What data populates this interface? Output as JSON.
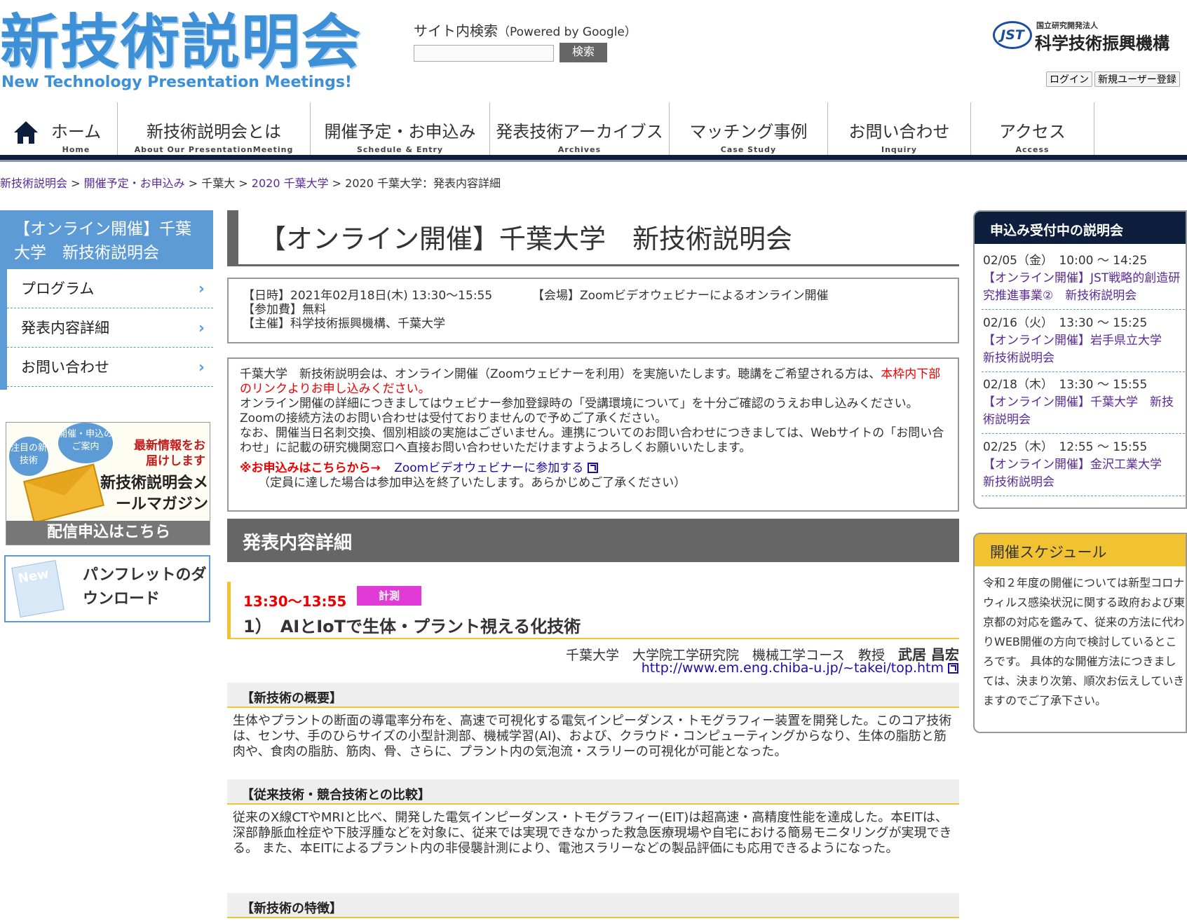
{
  "header": {
    "logo_main": "新技術説明会",
    "logo_sub": "New Technology Presentation Meetings!",
    "search_label": "サイト内検索",
    "search_powered": "（Powered by Google）",
    "search_button": "検索",
    "jst_small": "国立研究開発法人",
    "jst_name": "科学技術振興機構",
    "jst_mark": "JST",
    "login": "ログイン",
    "register": "新規ユーザー登録"
  },
  "nav": [
    {
      "jp": "ホーム",
      "en": "Home"
    },
    {
      "jp": "新技術説明会とは",
      "en": "About Our PresentationMeeting"
    },
    {
      "jp": "開催予定・お申込み",
      "en": "Schedule & Entry"
    },
    {
      "jp": "発表技術アーカイブス",
      "en": "Archives"
    },
    {
      "jp": "マッチング事例",
      "en": "Case Study"
    },
    {
      "jp": "お問い合わせ",
      "en": "Inquiry"
    },
    {
      "jp": "アクセス",
      "en": "Access"
    }
  ],
  "breadcrumb": {
    "b1": "新技術説明会",
    "b2": "開催予定・お申込み",
    "b3": "千葉大",
    "b4": "2020 千葉大学",
    "b5": "2020 千葉大学：発表内容詳細",
    "sep": " > "
  },
  "left_sidebar": {
    "title": "【オンライン開催】千葉大学　新技術説明会",
    "links": [
      "プログラム",
      "発表内容詳細",
      "お問い合わせ"
    ],
    "chevron": "›",
    "mailmag_bubble1": "注目の新技術",
    "mailmag_bubble2": "開催・申込のご案内",
    "mailmag_red": "最新情報をお届けします",
    "mailmag_name": "新技術説明会メールマガジン",
    "mailmag_foot": "配信申込はこちら",
    "pamphlet_img": "New",
    "pamphlet_text": "パンフレットのダウンロード"
  },
  "main": {
    "title": "【オンライン開催】千葉大学　新技術説明会",
    "info_date": "【日時】2021年02月18日(木) 13:30～15:55",
    "info_venue": "【会場】Zoomビデオウェビナーによるオンライン開催",
    "info_fee": "【参加費】無料",
    "info_host": "【主催】科学技術振興機構、千葉大学",
    "desc_1a": "千葉大学　新技術説明会は、オンライン開催（Zoomウェビナーを利用）を実施いたします。聴講をご希望される方は、",
    "desc_1b": "本枠内下部のリンクよりお申し込みください。",
    "desc_2": "オンライン開催の詳細につきましてはウェビナー参加登録時の「受講環境について」を十分ご確認のうえお申し込みください。Zoomの接続方法のお問い合わせは受付ておりませんので予めご了承ください。",
    "desc_3": "なお、開催当日名刺交換、個別相談の実施はございません。連携についてのお問い合わせにつきましては、Webサイトの「お問い合わせ」に記載の研究機関窓口へ直接お問い合わせいただけますようよろしくお願いいたします。",
    "apply_label": "※お申込みはこちらから→",
    "apply_link": "Zoomビデオウェビナーに参加する",
    "apply_note": "（定員に達した場合は参加申込を終了いたします。あらかじめご了承ください）",
    "section_head": "発表内容詳細",
    "talk_time": "13:30～13:55",
    "talk_badge": "計測",
    "talk_title": "1）　AIとIoTで生体・プラント視える化技術",
    "presenter_affil": "千葉大学　大学院工学研究院　機械工学コース　教授　",
    "presenter_name": "武居 昌宏",
    "presenter_url": "http://www.em.eng.chiba-u.jp/~takei/top.htm",
    "overview_head": "【新技術の概要】",
    "overview_body": "生体やプラントの断面の導電率分布を、高速で可視化する電気インピーダンス・トモグラフィー装置を開発した。このコア技術は、センサ、手のひらサイズの小型計測部、機械学習(AI)、および、クラウド・コンピューティングからなり、生体の脂肪と筋肉や、食肉の脂肪、筋肉、骨、さらに、プラント内の気泡流・スラリーの可視化が可能となった。",
    "compare_head": "【従来技術・競合技術との比較】",
    "compare_body": "従来のX線CTやMRIと比べ、開発した電気インピーダンス・トモグラフィー(EIT)は超高速・高精度性能を達成した。本EITは、深部静脈血栓症や下肢浮腫などを対象に、従来では実現できなかった救急医療現場や自宅における簡易モニタリングが実現できる。 また、本EITによるプラント内の非侵襲計測により、電池スラリーなどの製品評価にも応用できるようになった。",
    "features_head": "【新技術の特徴】"
  },
  "right_sidebar": {
    "accepting_head": "申込み受付中の説明会",
    "accepting": [
      {
        "date": "02/05（金）　10:00 ～ 14:25",
        "title": "【オンライン開催】JST戦略的創造研究推進事業②　新技術説明会"
      },
      {
        "date": "02/16（火）　13:30 ～ 15:25",
        "title": "【オンライン開催】岩手県立大学　新技術説明会"
      },
      {
        "date": "02/18（木）　13:30 ～ 15:55",
        "title": "【オンライン開催】千葉大学　新技術説明会"
      },
      {
        "date": "02/25（木）　12:55 ～ 15:55",
        "title": "【オンライン開催】金沢工業大学　新技術説明会"
      }
    ],
    "schedule_head": "開催スケジュール",
    "schedule_body": "令和２年度の開催については新型コロナウィルス感染状況に関する政府および東京都の対応を鑑みて、従来の方法に代わりWEB開催の方向で検討しているところです。 具体的な開催方法につきましては、決まり次第、順次お伝えしていきますのでご了承下さい。"
  },
  "colors": {
    "brand_blue": "#3d8fd6",
    "sidebar_blue": "#5c9bd6",
    "navy": "#0d1f3c",
    "accent_yellow": "#f1c232",
    "badge_magenta": "#e23ad6",
    "link_purple": "#5a2a9a",
    "alert_red": "#e00000"
  }
}
